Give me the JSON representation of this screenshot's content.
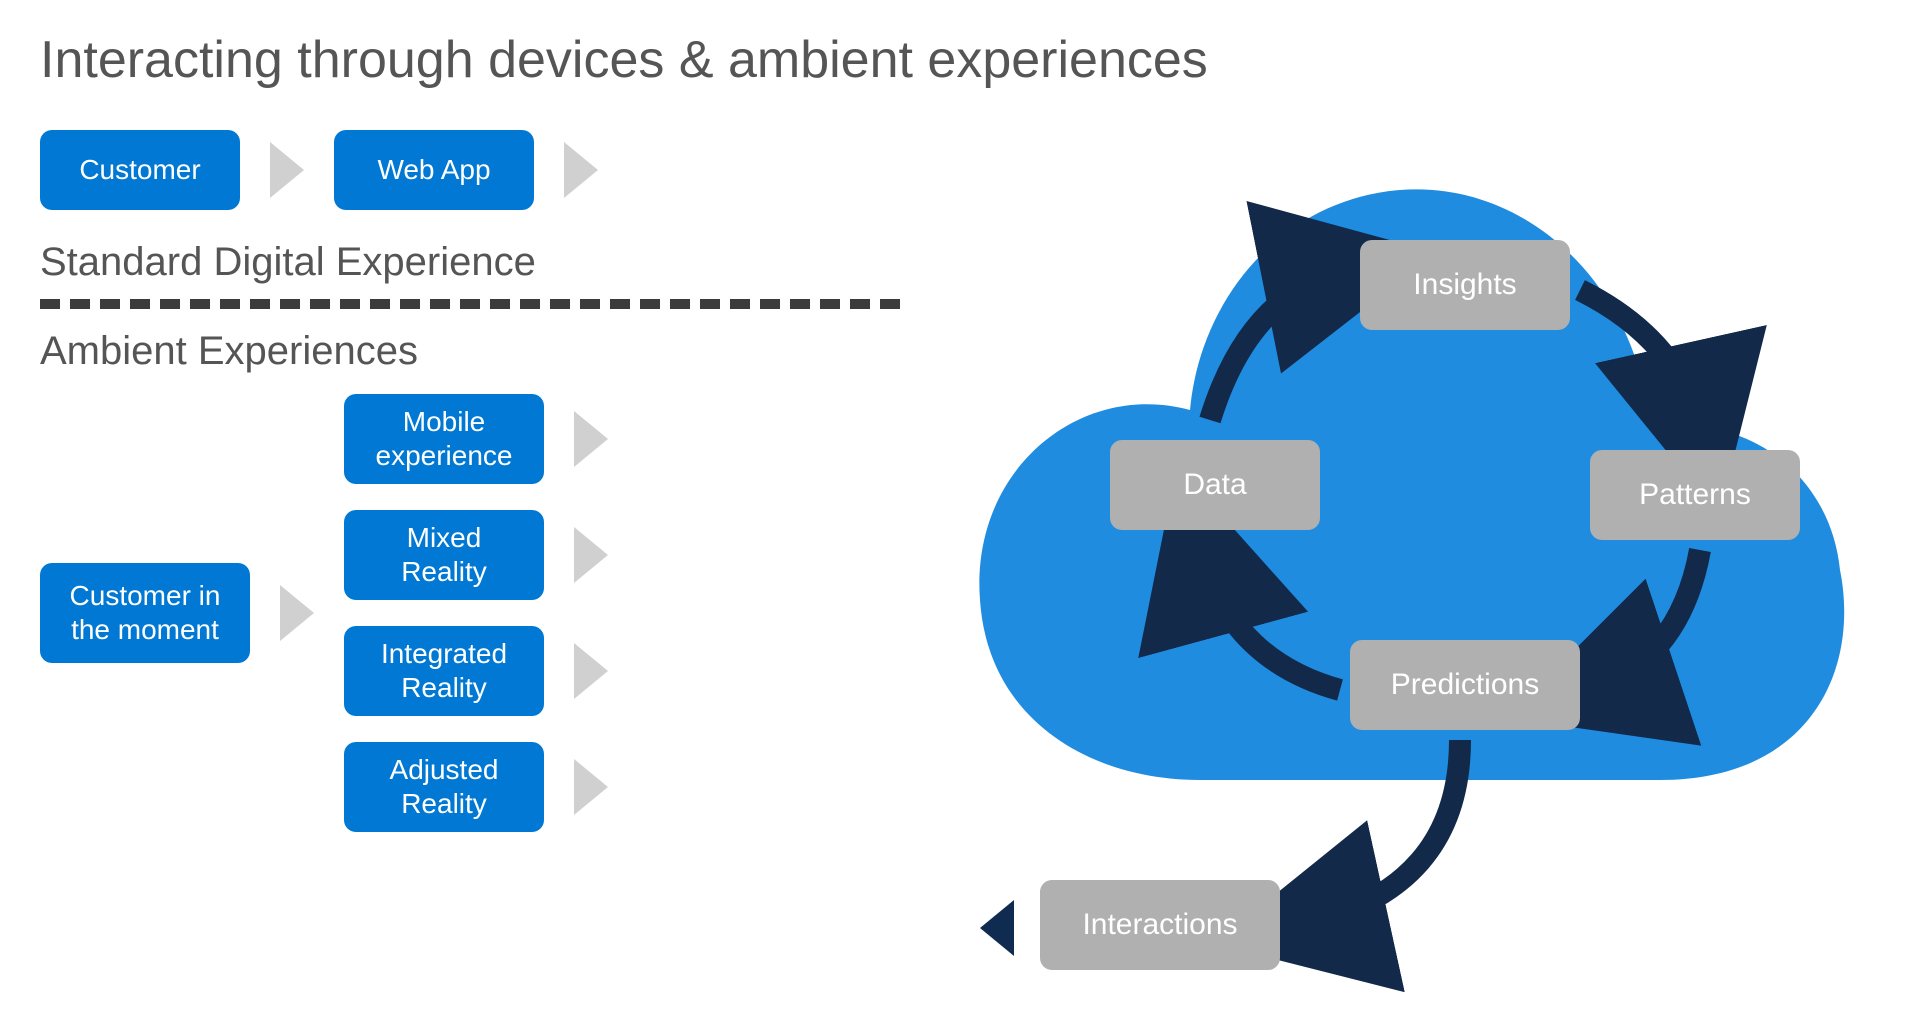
{
  "title": "Interacting through devices & ambient experiences",
  "standard": {
    "label": "Standard Digital Experience",
    "customer": "Customer",
    "webapp": "Web App"
  },
  "ambient": {
    "label": "Ambient Experiences",
    "customer": "Customer in the moment",
    "experiences": [
      "Mobile experience",
      "Mixed Reality",
      "Integrated Reality",
      "Adjusted Reality"
    ]
  },
  "cloud": {
    "nodes": {
      "insights": "Insights",
      "patterns": "Patterns",
      "predictions": "Predictions",
      "data": "Data",
      "interactions": "Interactions"
    }
  },
  "colors": {
    "accent": "#0078D4",
    "box_gray": "#b0b0b0",
    "arrow_dark": "#12294a",
    "chevron_gray": "#d0d0d0"
  }
}
